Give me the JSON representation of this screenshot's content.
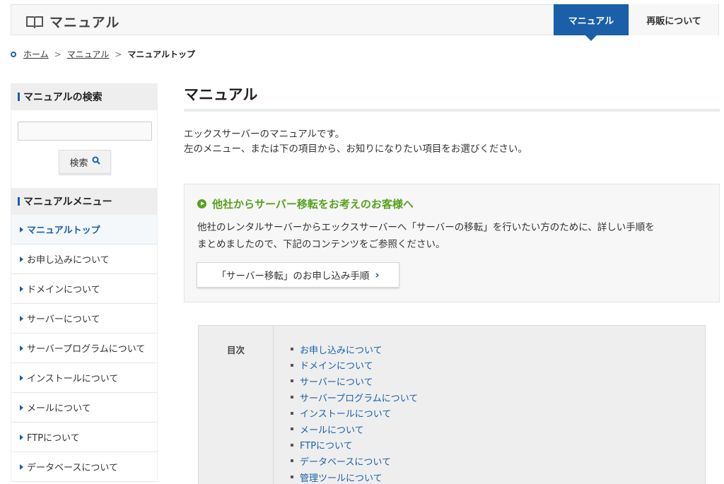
{
  "header": {
    "title": "マニュアル",
    "nav": [
      "マニュアル",
      "再販について"
    ]
  },
  "breadcrumb": {
    "items": [
      "ホーム",
      "マニュアル"
    ],
    "current": "マニュアルトップ",
    "separator": ">"
  },
  "sidebar": {
    "search_title": "マニュアルの検索",
    "search_button": "検索",
    "search_value": "",
    "menu_title": "マニュアルメニュー",
    "menu_items": [
      "マニュアルトップ",
      "お申し込みについて",
      "ドメインについて",
      "サーバーについて",
      "サーバープログラムについて",
      "インストールについて",
      "メールについて",
      "FTPについて",
      "データベースについて"
    ]
  },
  "main": {
    "title": "マニュアル",
    "intro_line1": "エックスサーバーのマニュアルです。",
    "intro_line2": "左のメニュー、または下の項目から、お知りになりたい項目をお選びください。",
    "migration": {
      "heading": "他社からサーバー移転をお考えのお客様へ",
      "text_line1": "他社のレンタルサーバーからエックスサーバーへ「サーバーの移転」を行いたい方のために、詳しい手順を",
      "text_line2": "まとめましたので、下記のコンテンツをご参照ください。",
      "button": "「サーバー移転」のお申し込み手順"
    },
    "toc": {
      "label": "目次",
      "items": [
        "お申し込みについて",
        "ドメインについて",
        "サーバーについて",
        "サーバープログラムについて",
        "インストールについて",
        "メールについて",
        "FTPについて",
        "データベースについて",
        "管理ツールについて"
      ]
    }
  },
  "colors": {
    "accent": "#1a5fa8",
    "green": "#56a21e"
  }
}
